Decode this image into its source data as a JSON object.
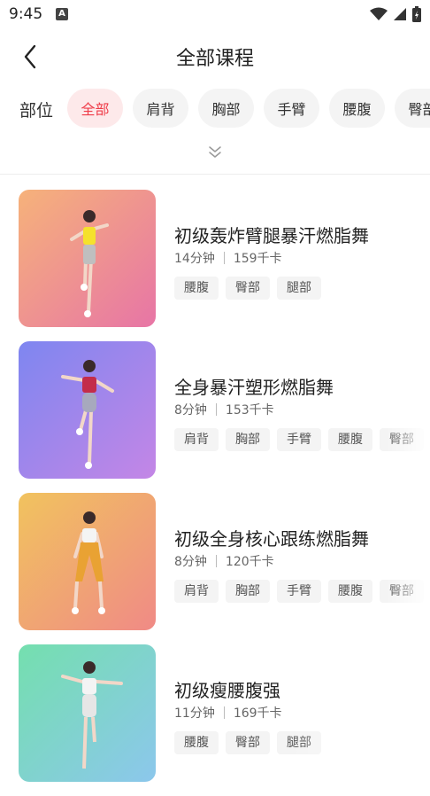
{
  "status_bar": {
    "time": "9:45",
    "notification_icon": "A"
  },
  "header": {
    "title": "全部课程"
  },
  "filter": {
    "label": "部位",
    "chips": [
      "全部",
      "肩背",
      "胸部",
      "手臂",
      "腰腹",
      "臀部"
    ],
    "active_index": 0
  },
  "courses": [
    {
      "title": "初级轰炸臂腿暴汗燃脂舞",
      "duration": "14分钟",
      "calories": "159千卡",
      "tags": [
        "腰腹",
        "臀部",
        "腿部"
      ],
      "thumb_colors": [
        "#f6b27a",
        "#e775a6"
      ]
    },
    {
      "title": "全身暴汗塑形燃脂舞",
      "duration": "8分钟",
      "calories": "153千卡",
      "tags": [
        "肩背",
        "胸部",
        "手臂",
        "腰腹",
        "臀部"
      ],
      "thumb_colors": [
        "#7e86f0",
        "#c486e6"
      ]
    },
    {
      "title": "初级全身核心跟练燃脂舞",
      "duration": "8分钟",
      "calories": "120千卡",
      "tags": [
        "肩背",
        "胸部",
        "手臂",
        "腰腹",
        "臀部"
      ],
      "thumb_colors": [
        "#f1c35e",
        "#f08a86"
      ]
    },
    {
      "title": "初级瘦腰腹强",
      "duration": "11分钟",
      "calories": "169千卡",
      "tags": [
        "腰腹",
        "臀部",
        "腿部"
      ],
      "thumb_colors": [
        "#74dfae",
        "#8cc7ec"
      ]
    }
  ],
  "colors": {
    "accent": "#ef3c49",
    "chip_bg": "#f4f4f4",
    "chip_active_bg": "#fde9ea"
  }
}
